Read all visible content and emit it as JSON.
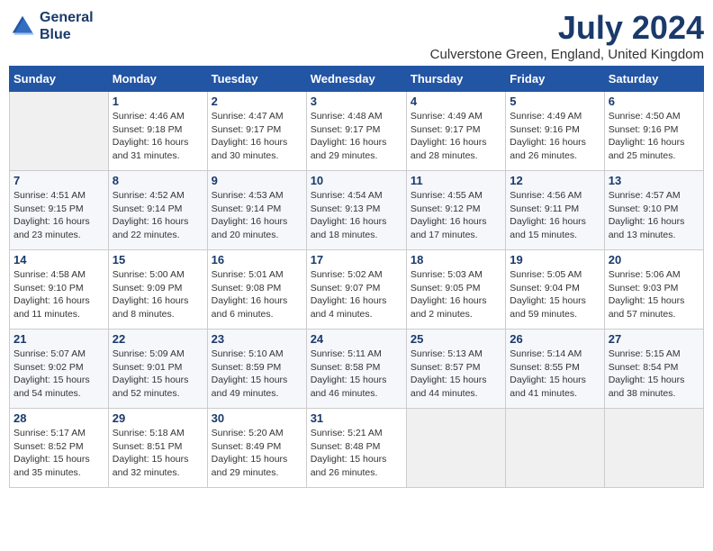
{
  "logo": {
    "line1": "General",
    "line2": "Blue"
  },
  "title": "July 2024",
  "location": "Culverstone Green, England, United Kingdom",
  "headers": [
    "Sunday",
    "Monday",
    "Tuesday",
    "Wednesday",
    "Thursday",
    "Friday",
    "Saturday"
  ],
  "weeks": [
    [
      {
        "day": "",
        "sunrise": "",
        "sunset": "",
        "daylight": ""
      },
      {
        "day": "1",
        "sunrise": "Sunrise: 4:46 AM",
        "sunset": "Sunset: 9:18 PM",
        "daylight": "Daylight: 16 hours and 31 minutes."
      },
      {
        "day": "2",
        "sunrise": "Sunrise: 4:47 AM",
        "sunset": "Sunset: 9:17 PM",
        "daylight": "Daylight: 16 hours and 30 minutes."
      },
      {
        "day": "3",
        "sunrise": "Sunrise: 4:48 AM",
        "sunset": "Sunset: 9:17 PM",
        "daylight": "Daylight: 16 hours and 29 minutes."
      },
      {
        "day": "4",
        "sunrise": "Sunrise: 4:49 AM",
        "sunset": "Sunset: 9:17 PM",
        "daylight": "Daylight: 16 hours and 28 minutes."
      },
      {
        "day": "5",
        "sunrise": "Sunrise: 4:49 AM",
        "sunset": "Sunset: 9:16 PM",
        "daylight": "Daylight: 16 hours and 26 minutes."
      },
      {
        "day": "6",
        "sunrise": "Sunrise: 4:50 AM",
        "sunset": "Sunset: 9:16 PM",
        "daylight": "Daylight: 16 hours and 25 minutes."
      }
    ],
    [
      {
        "day": "7",
        "sunrise": "Sunrise: 4:51 AM",
        "sunset": "Sunset: 9:15 PM",
        "daylight": "Daylight: 16 hours and 23 minutes."
      },
      {
        "day": "8",
        "sunrise": "Sunrise: 4:52 AM",
        "sunset": "Sunset: 9:14 PM",
        "daylight": "Daylight: 16 hours and 22 minutes."
      },
      {
        "day": "9",
        "sunrise": "Sunrise: 4:53 AM",
        "sunset": "Sunset: 9:14 PM",
        "daylight": "Daylight: 16 hours and 20 minutes."
      },
      {
        "day": "10",
        "sunrise": "Sunrise: 4:54 AM",
        "sunset": "Sunset: 9:13 PM",
        "daylight": "Daylight: 16 hours and 18 minutes."
      },
      {
        "day": "11",
        "sunrise": "Sunrise: 4:55 AM",
        "sunset": "Sunset: 9:12 PM",
        "daylight": "Daylight: 16 hours and 17 minutes."
      },
      {
        "day": "12",
        "sunrise": "Sunrise: 4:56 AM",
        "sunset": "Sunset: 9:11 PM",
        "daylight": "Daylight: 16 hours and 15 minutes."
      },
      {
        "day": "13",
        "sunrise": "Sunrise: 4:57 AM",
        "sunset": "Sunset: 9:10 PM",
        "daylight": "Daylight: 16 hours and 13 minutes."
      }
    ],
    [
      {
        "day": "14",
        "sunrise": "Sunrise: 4:58 AM",
        "sunset": "Sunset: 9:10 PM",
        "daylight": "Daylight: 16 hours and 11 minutes."
      },
      {
        "day": "15",
        "sunrise": "Sunrise: 5:00 AM",
        "sunset": "Sunset: 9:09 PM",
        "daylight": "Daylight: 16 hours and 8 minutes."
      },
      {
        "day": "16",
        "sunrise": "Sunrise: 5:01 AM",
        "sunset": "Sunset: 9:08 PM",
        "daylight": "Daylight: 16 hours and 6 minutes."
      },
      {
        "day": "17",
        "sunrise": "Sunrise: 5:02 AM",
        "sunset": "Sunset: 9:07 PM",
        "daylight": "Daylight: 16 hours and 4 minutes."
      },
      {
        "day": "18",
        "sunrise": "Sunrise: 5:03 AM",
        "sunset": "Sunset: 9:05 PM",
        "daylight": "Daylight: 16 hours and 2 minutes."
      },
      {
        "day": "19",
        "sunrise": "Sunrise: 5:05 AM",
        "sunset": "Sunset: 9:04 PM",
        "daylight": "Daylight: 15 hours and 59 minutes."
      },
      {
        "day": "20",
        "sunrise": "Sunrise: 5:06 AM",
        "sunset": "Sunset: 9:03 PM",
        "daylight": "Daylight: 15 hours and 57 minutes."
      }
    ],
    [
      {
        "day": "21",
        "sunrise": "Sunrise: 5:07 AM",
        "sunset": "Sunset: 9:02 PM",
        "daylight": "Daylight: 15 hours and 54 minutes."
      },
      {
        "day": "22",
        "sunrise": "Sunrise: 5:09 AM",
        "sunset": "Sunset: 9:01 PM",
        "daylight": "Daylight: 15 hours and 52 minutes."
      },
      {
        "day": "23",
        "sunrise": "Sunrise: 5:10 AM",
        "sunset": "Sunset: 8:59 PM",
        "daylight": "Daylight: 15 hours and 49 minutes."
      },
      {
        "day": "24",
        "sunrise": "Sunrise: 5:11 AM",
        "sunset": "Sunset: 8:58 PM",
        "daylight": "Daylight: 15 hours and 46 minutes."
      },
      {
        "day": "25",
        "sunrise": "Sunrise: 5:13 AM",
        "sunset": "Sunset: 8:57 PM",
        "daylight": "Daylight: 15 hours and 44 minutes."
      },
      {
        "day": "26",
        "sunrise": "Sunrise: 5:14 AM",
        "sunset": "Sunset: 8:55 PM",
        "daylight": "Daylight: 15 hours and 41 minutes."
      },
      {
        "day": "27",
        "sunrise": "Sunrise: 5:15 AM",
        "sunset": "Sunset: 8:54 PM",
        "daylight": "Daylight: 15 hours and 38 minutes."
      }
    ],
    [
      {
        "day": "28",
        "sunrise": "Sunrise: 5:17 AM",
        "sunset": "Sunset: 8:52 PM",
        "daylight": "Daylight: 15 hours and 35 minutes."
      },
      {
        "day": "29",
        "sunrise": "Sunrise: 5:18 AM",
        "sunset": "Sunset: 8:51 PM",
        "daylight": "Daylight: 15 hours and 32 minutes."
      },
      {
        "day": "30",
        "sunrise": "Sunrise: 5:20 AM",
        "sunset": "Sunset: 8:49 PM",
        "daylight": "Daylight: 15 hours and 29 minutes."
      },
      {
        "day": "31",
        "sunrise": "Sunrise: 5:21 AM",
        "sunset": "Sunset: 8:48 PM",
        "daylight": "Daylight: 15 hours and 26 minutes."
      },
      {
        "day": "",
        "sunrise": "",
        "sunset": "",
        "daylight": ""
      },
      {
        "day": "",
        "sunrise": "",
        "sunset": "",
        "daylight": ""
      },
      {
        "day": "",
        "sunrise": "",
        "sunset": "",
        "daylight": ""
      }
    ]
  ]
}
